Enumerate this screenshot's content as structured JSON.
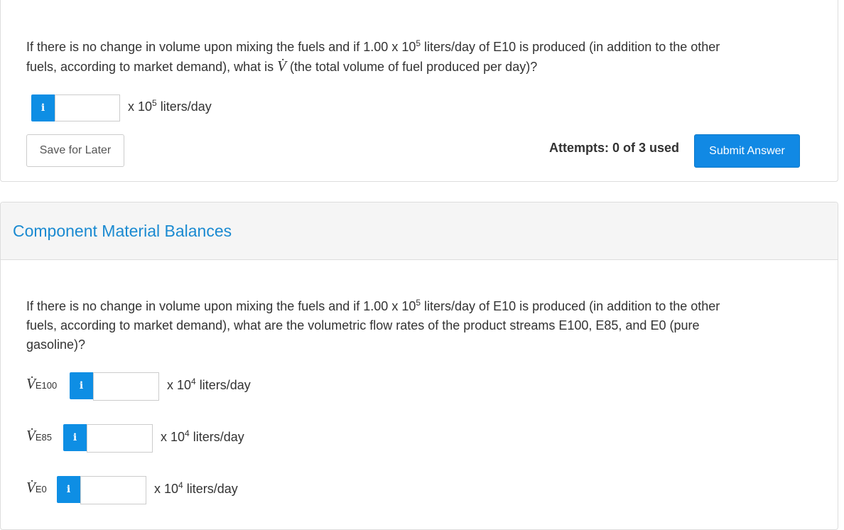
{
  "q1": {
    "line1_pre": "If there is no change in volume upon mixing the fuels and if 1.00 x 10",
    "sup": "5",
    "line1_post": " liters/day of E10 is produced (in addition to the other",
    "line2_pre": "fuels, according to market demand), what is ",
    "v_symbol": "V̇",
    "line2_post": " (the total volume of fuel produced per day)?",
    "info_icon": "i",
    "input_value": "",
    "unit_pre": "x 10",
    "unit_sup": "5",
    "unit_post": " liters/day"
  },
  "actions": {
    "save_label": "Save for Later",
    "attempts": "Attempts: 0 of 3 used",
    "submit_label": "Submit Answer"
  },
  "section2": {
    "title": "Component Material Balances",
    "q_line1_pre": "If there is no change in volume upon mixing the fuels and if 1.00 x 10",
    "q_sup": "5",
    "q_line1_post": " liters/day of E10 is produced (in addition to the other",
    "q_line2": "fuels, according to market demand), what are the volumetric flow rates of the product streams E100, E85, and E0 (pure",
    "q_line3": "gasoline)?",
    "rows": [
      {
        "symbol": "V̇",
        "sub": "E100",
        "icon": "i",
        "value": "",
        "unit_pre": "x 10",
        "unit_sup": "4",
        "unit_post": " liters/day"
      },
      {
        "symbol": "V̇",
        "sub": "E85",
        "icon": "i",
        "value": "",
        "unit_pre": "x 10",
        "unit_sup": "4",
        "unit_post": " liters/day"
      },
      {
        "symbol": "V̇",
        "sub": "E0",
        "icon": "i",
        "value": "",
        "unit_pre": "x 10",
        "unit_sup": "4",
        "unit_post": " liters/day"
      }
    ]
  },
  "colors": {
    "accent": "#1189e4",
    "title": "#1a8ad1",
    "header_bg": "#f5f5f5"
  }
}
